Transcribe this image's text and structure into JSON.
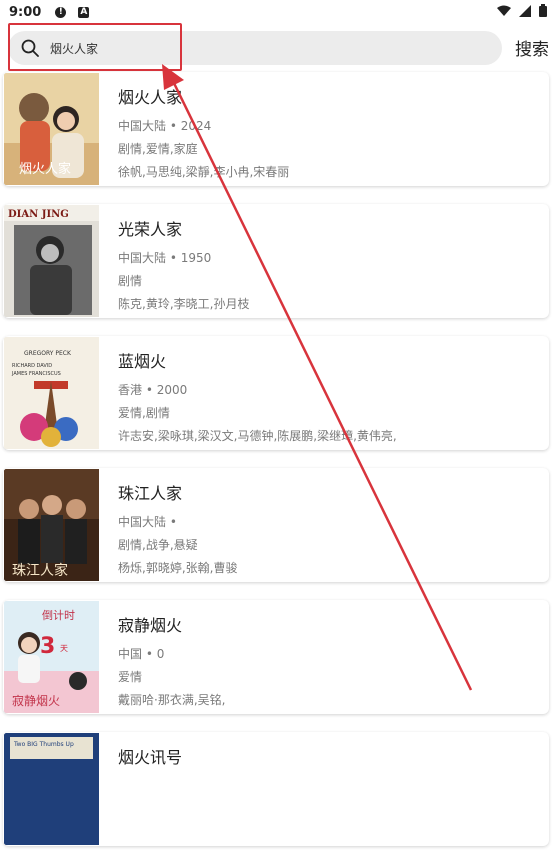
{
  "status_bar": {
    "time": "9:00"
  },
  "search": {
    "query": "烟火人家",
    "button_label": "搜索"
  },
  "results": [
    {
      "title": "烟火人家",
      "meta": "中国大陆 • 2024",
      "genre": "剧情,爱情,家庭",
      "cast": "徐帆,马思纯,梁靜,李小冉,宋春丽",
      "poster_text": "烟火人家"
    },
    {
      "title": "光荣人家",
      "meta": "中国大陆 • 1950",
      "genre": "剧情",
      "cast": "陈克,黄玲,李晓工,孙月枝",
      "poster_text": "DIAN JING"
    },
    {
      "title": "蓝烟火",
      "meta": "香港 • 2000",
      "genre": "爱情,剧情",
      "cast": "许志安,梁咏琪,梁汉文,马德钟,陈展鹏,梁继璋,黄伟亮,",
      "poster_text": "GREGORY PECK"
    },
    {
      "title": "珠江人家",
      "meta": "中国大陆 •",
      "genre": "剧情,战争,悬疑",
      "cast": "杨烁,郭晓婷,张翰,曹骏",
      "poster_text": "珠江人家"
    },
    {
      "title": "寂静烟火",
      "meta": "中国 • 0",
      "genre": "爱情",
      "cast": "戴丽哈·那衣满,吴铭,",
      "poster_text": "倒计时3天"
    },
    {
      "title": "烟火讯号",
      "meta": "",
      "genre": "",
      "cast": "",
      "poster_text": "Two BIG Thumbs Up"
    }
  ],
  "colors": {
    "annotation_red": "#d8343c",
    "search_bg": "#ececec"
  }
}
